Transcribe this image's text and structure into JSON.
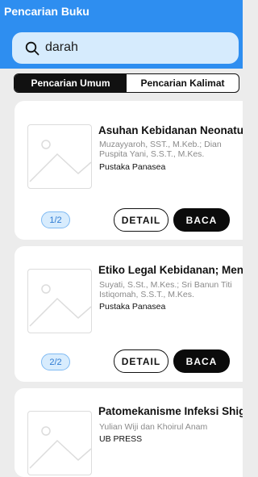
{
  "header": {
    "title": "Pencarian Buku"
  },
  "search": {
    "value": "darah",
    "icon": "search-icon"
  },
  "tabs": [
    {
      "label": "Pencarian Umum",
      "active": true
    },
    {
      "label": "Pencarian Kalimat",
      "active": false
    }
  ],
  "books": [
    {
      "title": "Asuhan Kebidanan Neonatu",
      "author": "Muzayyaroh, SST., M.Keb.; Dian Puspita Yani, S.S.T., M.Kes.",
      "publisher": "Pustaka Panasea",
      "page": "1/2",
      "detail_label": "DETAIL",
      "read_label": "BACA"
    },
    {
      "title": "Etiko Legal Kebidanan; Men",
      "author": "Suyati, S.St., M.Kes.; Sri Banun Titi Istiqomah, S.S.T., M.Kes.",
      "publisher": "Pustaka Panasea",
      "page": "2/2",
      "detail_label": "DETAIL",
      "read_label": "BACA"
    },
    {
      "title": "Patomekanisme Infeksi Shig",
      "author": "Yulian Wiji dan Khoirul Anam",
      "publisher": "UB PRESS"
    }
  ],
  "colors": {
    "header": "#2e8ef0",
    "search_bg": "#d6ebfd",
    "accent": "#111111"
  }
}
